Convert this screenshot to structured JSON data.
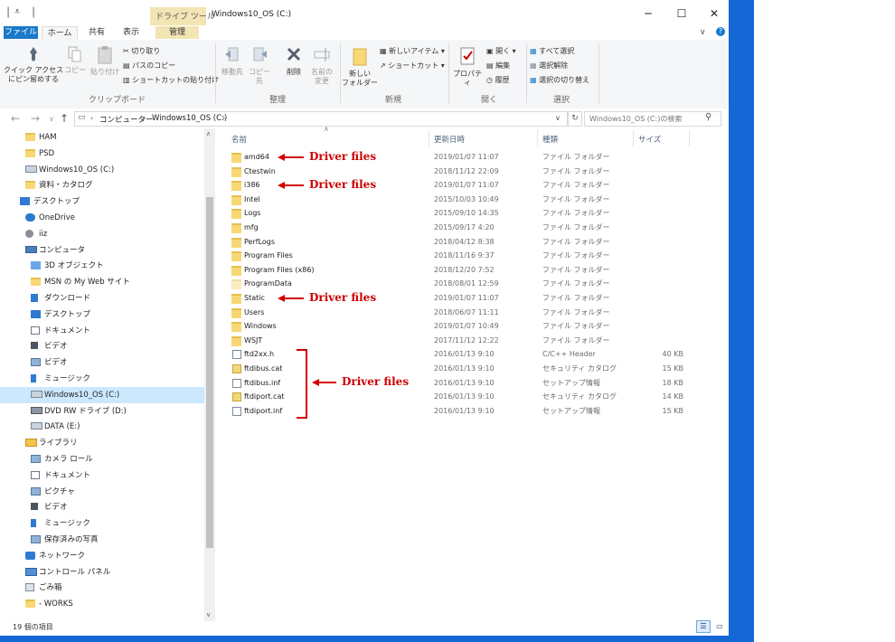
{
  "window": {
    "title": "Windows10_OS (C:)",
    "context_tab_header": "ドライブ ツール",
    "controls": {
      "minimize": "─",
      "maximize": "☐",
      "close": "✕"
    }
  },
  "tabs": {
    "file": "ファイル",
    "home": "ホーム",
    "share": "共有",
    "view": "表示",
    "manage": "管理"
  },
  "ribbon": {
    "clipboard": {
      "group": "クリップボード",
      "pin": "クイック アクセス\nにピン留めする",
      "copy": "コピー",
      "paste": "貼り付け",
      "cut": "切り取り",
      "copy_path": "パスのコピー",
      "paste_shortcut": "ショートカットの貼り付け"
    },
    "organize": {
      "group": "整理",
      "move_to": "移動先",
      "copy_to": "コピー先",
      "delete": "削除",
      "rename": "名前の\n変更"
    },
    "new": {
      "group": "新規",
      "new_folder": "新しい\nフォルダー",
      "new_item": "新しいアイテム",
      "shortcut": "ショートカット"
    },
    "open": {
      "group": "開く",
      "properties": "プロパティ",
      "open": "開く",
      "edit": "編集",
      "history": "履歴"
    },
    "select": {
      "group": "選択",
      "select_all": "すべて選択",
      "select_none": "選択解除",
      "invert": "選択の切り替え"
    }
  },
  "address": {
    "crumbs": [
      "コンピューター",
      "Windows10_OS (C:)"
    ],
    "search_placeholder": "Windows10_OS (C:)の検索"
  },
  "nav": [
    {
      "label": "HAM",
      "icon": "folder",
      "indent": 1
    },
    {
      "label": "PSD",
      "icon": "folder",
      "indent": 1
    },
    {
      "label": "Windows10_OS (C:)",
      "icon": "drive",
      "indent": 1
    },
    {
      "label": "資料・カタログ",
      "icon": "folder",
      "indent": 1
    },
    {
      "label": "デスクトップ",
      "icon": "desktop",
      "indent": 0
    },
    {
      "label": "OneDrive",
      "icon": "cloud",
      "indent": 1
    },
    {
      "label": "iiz",
      "icon": "user",
      "indent": 1
    },
    {
      "label": "コンピュータ",
      "icon": "computer",
      "indent": 1
    },
    {
      "label": "3D オブジェクト",
      "icon": "cube",
      "indent": 2
    },
    {
      "label": "MSN の My Web サイト",
      "icon": "folder",
      "indent": 2
    },
    {
      "label": "ダウンロード",
      "icon": "download",
      "indent": 2
    },
    {
      "label": "デスクトップ",
      "icon": "desktop",
      "indent": 2
    },
    {
      "label": "ドキュメント",
      "icon": "document",
      "indent": 2
    },
    {
      "label": "ビデオ",
      "icon": "video",
      "indent": 2
    },
    {
      "label": "ビデオ",
      "icon": "picture",
      "indent": 2
    },
    {
      "label": "ミュージック",
      "icon": "music",
      "indent": 2
    },
    {
      "label": "Windows10_OS (C:)",
      "icon": "drive",
      "indent": 2,
      "selected": true
    },
    {
      "label": "DVD RW ドライブ (D:)",
      "icon": "dvd",
      "indent": 2
    },
    {
      "label": "DATA (E:)",
      "icon": "drive",
      "indent": 2
    },
    {
      "label": "ライブラリ",
      "icon": "library",
      "indent": 1
    },
    {
      "label": "カメラ ロール",
      "icon": "picture",
      "indent": 2
    },
    {
      "label": "ドキュメント",
      "icon": "document",
      "indent": 2
    },
    {
      "label": "ピクチャ",
      "icon": "picture",
      "indent": 2
    },
    {
      "label": "ビデオ",
      "icon": "video",
      "indent": 2
    },
    {
      "label": "ミュージック",
      "icon": "music",
      "indent": 2
    },
    {
      "label": "保存済みの写真",
      "icon": "picture",
      "indent": 2
    },
    {
      "label": "ネットワーク",
      "icon": "network",
      "indent": 1
    },
    {
      "label": "コントロール パネル",
      "icon": "control",
      "indent": 1
    },
    {
      "label": "ごみ箱",
      "icon": "trash",
      "indent": 1
    },
    {
      "label": "- WORKS",
      "icon": "folder",
      "indent": 1
    }
  ],
  "columns": {
    "name": "名前",
    "date": "更新日時",
    "type": "種類",
    "size": "サイズ"
  },
  "files": [
    {
      "name": "amd64",
      "date": "2019/01/07 11:07",
      "type": "ファイル フォルダー",
      "size": "",
      "icon": "folder"
    },
    {
      "name": "Ctestwin",
      "date": "2018/11/12 22:09",
      "type": "ファイル フォルダー",
      "size": "",
      "icon": "folder"
    },
    {
      "name": "i386",
      "date": "2019/01/07 11:07",
      "type": "ファイル フォルダー",
      "size": "",
      "icon": "folder"
    },
    {
      "name": "Intel",
      "date": "2015/10/03 10:49",
      "type": "ファイル フォルダー",
      "size": "",
      "icon": "folder"
    },
    {
      "name": "Logs",
      "date": "2015/09/10 14:35",
      "type": "ファイル フォルダー",
      "size": "",
      "icon": "folder"
    },
    {
      "name": "mfg",
      "date": "2015/09/17 4:20",
      "type": "ファイル フォルダー",
      "size": "",
      "icon": "folder"
    },
    {
      "name": "PerfLogs",
      "date": "2018/04/12 8:38",
      "type": "ファイル フォルダー",
      "size": "",
      "icon": "folder"
    },
    {
      "name": "Program Files",
      "date": "2018/11/16 9:37",
      "type": "ファイル フォルダー",
      "size": "",
      "icon": "folder"
    },
    {
      "name": "Program Files (x86)",
      "date": "2018/12/20 7:52",
      "type": "ファイル フォルダー",
      "size": "",
      "icon": "folder"
    },
    {
      "name": "ProgramData",
      "date": "2018/08/01 12:59",
      "type": "ファイル フォルダー",
      "size": "",
      "icon": "folder-faded"
    },
    {
      "name": "Static",
      "date": "2019/01/07 11:07",
      "type": "ファイル フォルダー",
      "size": "",
      "icon": "folder"
    },
    {
      "name": "Users",
      "date": "2018/06/07 11:11",
      "type": "ファイル フォルダー",
      "size": "",
      "icon": "folder"
    },
    {
      "name": "Windows",
      "date": "2019/01/07 10:49",
      "type": "ファイル フォルダー",
      "size": "",
      "icon": "folder"
    },
    {
      "name": "WSJT",
      "date": "2017/11/12 12:22",
      "type": "ファイル フォルダー",
      "size": "",
      "icon": "folder"
    },
    {
      "name": "ftd2xx.h",
      "date": "2016/01/13 9:10",
      "type": "C/C++ Header",
      "size": "40 KB",
      "icon": "file"
    },
    {
      "name": "ftdibus.cat",
      "date": "2016/01/13 9:10",
      "type": "セキュリティ カタログ",
      "size": "15 KB",
      "icon": "cert"
    },
    {
      "name": "ftdibus.inf",
      "date": "2016/01/13 9:10",
      "type": "セットアップ情報",
      "size": "18 KB",
      "icon": "file"
    },
    {
      "name": "ftdiport.cat",
      "date": "2016/01/13 9:10",
      "type": "セキュリティ カタログ",
      "size": "14 KB",
      "icon": "cert"
    },
    {
      "name": "ftdiport.inf",
      "date": "2016/01/13 9:10",
      "type": "セットアップ情報",
      "size": "15 KB",
      "icon": "file"
    }
  ],
  "annotations": {
    "label": "Driver files",
    "marked_rows": [
      0,
      2,
      10
    ],
    "bracket_rows": [
      14,
      18
    ]
  },
  "status": {
    "count": "19 個の項目"
  },
  "colors": {
    "accent": "#1979ca",
    "annotation": "#d40000",
    "context_tab": "#f3e4b4",
    "desktop": "#1567d6"
  }
}
